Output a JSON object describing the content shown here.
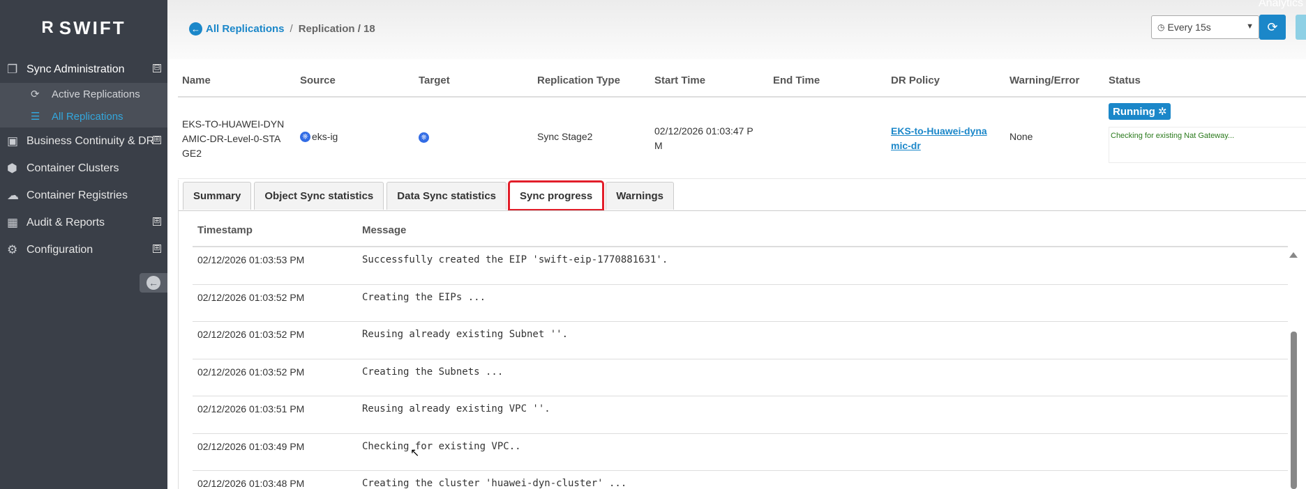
{
  "brand": {
    "mark": "R",
    "name": "SWIFT"
  },
  "sidebar": {
    "items": [
      {
        "label": "Sync Administration",
        "icon": "copy-icon",
        "expander": "⊟",
        "open": true
      },
      {
        "label": "Business Continuity & DR",
        "icon": "server-icon",
        "expander": "⊞"
      },
      {
        "label": "Container Clusters",
        "icon": "cube-icon",
        "expander": ""
      },
      {
        "label": "Container Registries",
        "icon": "cloud-icon",
        "expander": ""
      },
      {
        "label": "Audit & Reports",
        "icon": "table-icon",
        "expander": "⊞"
      },
      {
        "label": "Configuration",
        "icon": "gears-icon",
        "expander": "⊞"
      }
    ],
    "sub_items": [
      {
        "label": "Active Replications",
        "icon": "refresh-icon"
      },
      {
        "label": "All Replications",
        "icon": "list-icon",
        "active": true
      }
    ]
  },
  "header": {
    "breadcrumb_link": "All Replications",
    "breadcrumb_sep": "/",
    "breadcrumb_current": "Replication / 18",
    "analytics_label": "Analytics",
    "refresh_interval": "Every 15s"
  },
  "replication": {
    "columns": [
      "Name",
      "Source",
      "Target",
      "Replication Type",
      "Start Time",
      "End Time",
      "DR Policy",
      "Warning/Error",
      "Status"
    ],
    "row": {
      "name": "EKS-TO-HUAWEI-DYNAMIC-DR-Level-0-STAGE2",
      "source": "eks-ig",
      "target": "",
      "type": "Sync Stage2",
      "start_time": "02/12/2026 01:03:47 PM",
      "end_time": "",
      "dr_policy": "EKS-to-Huawei-dynamic-dr",
      "warning": "None",
      "status": "Running",
      "status_message": "Checking for existing Nat Gateway..."
    }
  },
  "tabs": [
    {
      "label": "Summary"
    },
    {
      "label": "Object Sync statistics"
    },
    {
      "label": "Data Sync statistics"
    },
    {
      "label": "Sync progress",
      "active": true
    },
    {
      "label": "Warnings"
    }
  ],
  "progress": {
    "columns": [
      "Timestamp",
      "Message"
    ],
    "rows": [
      {
        "timestamp": "02/12/2026 01:03:53 PM",
        "message": "Successfully created the EIP 'swift-eip-1770881631'."
      },
      {
        "timestamp": "02/12/2026 01:03:52 PM",
        "message": "Creating the EIPs ..."
      },
      {
        "timestamp": "02/12/2026 01:03:52 PM",
        "message": "Reusing already existing Subnet ''."
      },
      {
        "timestamp": "02/12/2026 01:03:52 PM",
        "message": "Creating the Subnets ..."
      },
      {
        "timestamp": "02/12/2026 01:03:51 PM",
        "message": "Reusing already existing VPC ''."
      },
      {
        "timestamp": "02/12/2026 01:03:49 PM",
        "message": "Checking for existing VPC.."
      },
      {
        "timestamp": "02/12/2026 01:03:48 PM",
        "message": "Creating the cluster 'huawei-dyn-cluster' ..."
      }
    ]
  },
  "colors": {
    "sidebar_bg": "#3a3f48",
    "accent": "#1b87c9",
    "active_tab_outline": "#e21e2a",
    "status_text": "#2a7a1c"
  }
}
